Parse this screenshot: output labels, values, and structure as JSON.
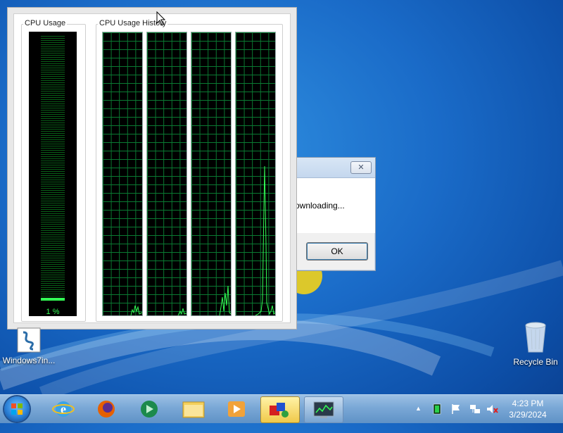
{
  "perf_window": {
    "cpu_usage_title": "CPU Usage",
    "cpu_history_title": "CPU Usage History",
    "cpu_percent_label": "1 %",
    "cpu_percent": 1
  },
  "dialog": {
    "close_glyph": "✕",
    "message": "ownloading...",
    "ok_label": "OK"
  },
  "desktop": {
    "icons": [
      {
        "label": "Windows7in...",
        "icon": "installer-icon"
      },
      {
        "label": "Recycle Bin",
        "icon": "recycle-bin-icon"
      }
    ]
  },
  "taskbar": {
    "pinned": [
      {
        "name": "internet-explorer-icon"
      },
      {
        "name": "firefox-icon"
      },
      {
        "name": "media-center-icon"
      },
      {
        "name": "file-explorer-icon"
      },
      {
        "name": "media-player-icon"
      },
      {
        "name": "shapes-app-icon"
      },
      {
        "name": "task-manager-icon"
      }
    ],
    "tray": {
      "show_hidden_glyph": "▲"
    },
    "clock": {
      "time": "4:23 PM",
      "date": "3/29/2024"
    }
  },
  "colors": {
    "graph_line": "#33ff55",
    "grid": "#0a7a32",
    "desktop_blue": "#1a6bc8"
  }
}
